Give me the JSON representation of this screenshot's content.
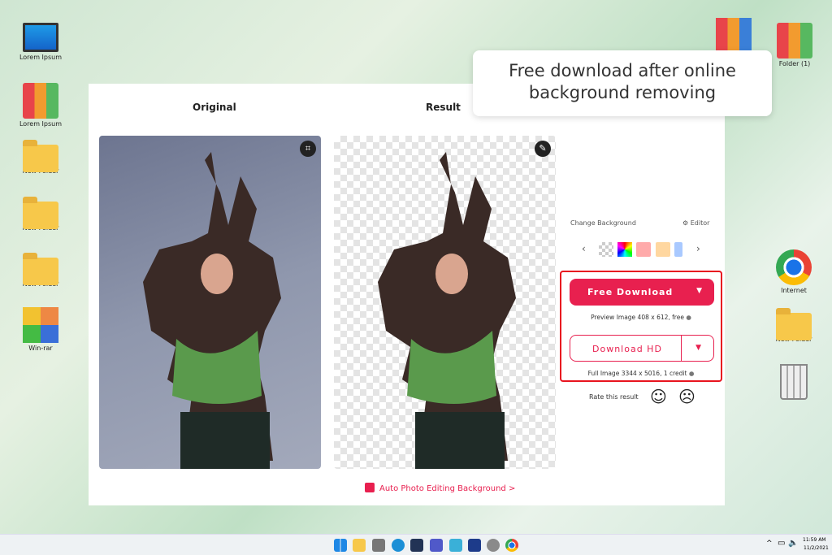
{
  "desktop": {
    "left_icons": [
      "Lorem Ipsum",
      "Lorem Ipsum",
      "New Folder",
      "New Folder",
      "New Folder",
      "Win-rar"
    ],
    "right_icons": [
      "Folder (1)",
      "Internet",
      "New Folder"
    ]
  },
  "tooltip": "Free download after online background removing",
  "panel": {
    "original_label": "Original",
    "result_label": "Result",
    "change_background": "Change Background",
    "editor": "Editor",
    "free_download": "Free Download",
    "preview_note": "Preview Image 408 x 612, free",
    "download_hd": "Download HD",
    "full_note": "Full Image 3344 x 5016, 1 credit",
    "rate": "Rate this result",
    "footer_link": "Auto Photo Editing Background >"
  },
  "swatch_colors": [
    "#ffaaaa",
    "#ffd7a0",
    "#a9c9ff"
  ],
  "taskbar": {
    "time": "11:59 AM",
    "date": "11/2/2021"
  }
}
